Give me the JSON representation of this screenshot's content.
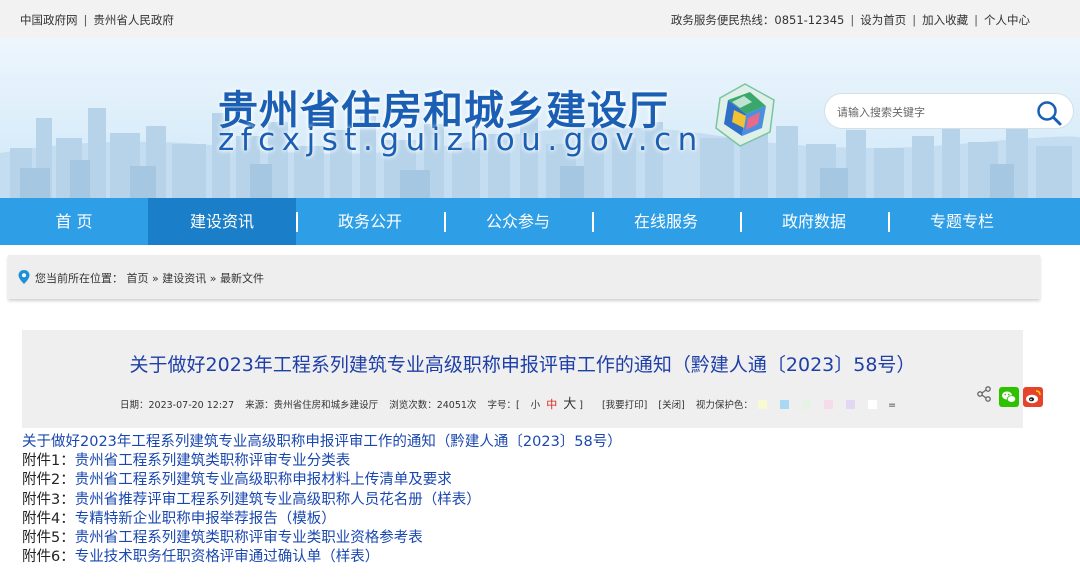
{
  "topbar": {
    "left_links": [
      "中国政府网",
      "贵州省人民政府"
    ],
    "hotline": "政务服务便民热线：0851-12345",
    "right_links": [
      "设为首页",
      "加入收藏",
      "个人中心"
    ]
  },
  "header": {
    "title": "贵州省住房和城乡建设厅",
    "domain": "zfcxjst.guizhou.gov.cn",
    "search_placeholder": "请输入搜索关键字"
  },
  "nav": {
    "items": [
      "首 页",
      "建设资讯",
      "政务公开",
      "公众参与",
      "在线服务",
      "政府数据",
      "专题专栏"
    ],
    "active_index": 1
  },
  "breadcrumb": {
    "prefix": "您当前所在位置：",
    "items": [
      "首页",
      "建设资讯",
      "最新文件"
    ],
    "separator": "»"
  },
  "article": {
    "title": "关于做好2023年工程系列建筑专业高级职称申报评审工作的通知（黔建人通〔2023〕58号）",
    "date": "日期：2023-07-20 12:27",
    "source": "来源：贵州省住房和城乡建设厅",
    "views": "浏览次数：24051次",
    "font_label": "字号：[",
    "font_small": "小",
    "font_medium": "中",
    "font_large": "大",
    "font_close": "]",
    "print": "[我要打印]",
    "close": "[关闭]",
    "eye_label": "视力保护色：",
    "eye_reset": "=",
    "swatch_colors": [
      "#fafad2",
      "#a9d8f5",
      "#e6f2e6",
      "#f5dce8",
      "#e0d8f5",
      "#ffffff"
    ]
  },
  "links": [
    {
      "prefix": "",
      "text": "关于做好2023年工程系列建筑专业高级职称申报评审工作的通知（黔建人通〔2023〕58号）"
    },
    {
      "prefix": "附件1：",
      "text": "贵州省工程系列建筑类职称评审专业分类表"
    },
    {
      "prefix": "附件2：",
      "text": "贵州省工程系列建筑专业高级职称申报材料上传清单及要求"
    },
    {
      "prefix": "附件3：",
      "text": "贵州省推荐评审工程系列建筑专业高级职称人员花名册（样表）"
    },
    {
      "prefix": "附件4：",
      "text": "专精特新企业职称申报举荐报告（模板）"
    },
    {
      "prefix": "附件5：",
      "text": "贵州省工程系列建筑类职称评审专业类职业资格参考表"
    },
    {
      "prefix": "附件6：",
      "text": "专业技术职务任职资格评审通过确认单（样表）"
    }
  ],
  "colors": {
    "nav_bg": "#2e9fe6",
    "nav_active": "#1a7fc8",
    "title_blue": "#1a5fb4",
    "link_blue": "#1a48b0",
    "wechat_green": "#2dc100",
    "weibo_red": "#e6432d"
  },
  "icons": [
    "location-pin-icon",
    "search-icon",
    "share-icon",
    "wechat-icon",
    "weibo-icon"
  ]
}
